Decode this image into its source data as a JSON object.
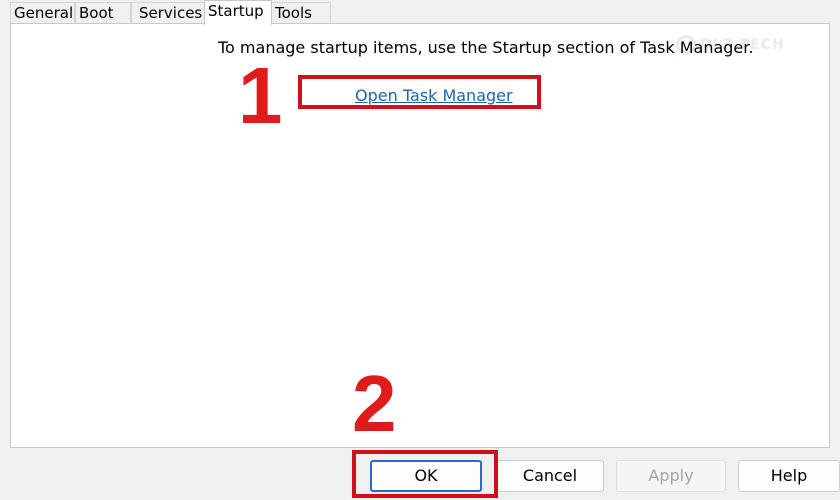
{
  "tabs": [
    {
      "label": "General",
      "active": false
    },
    {
      "label": "Boot",
      "active": false
    },
    {
      "label": "Services",
      "active": false
    },
    {
      "label": "Startup",
      "active": true
    },
    {
      "label": "Tools",
      "active": false
    }
  ],
  "startup": {
    "info_text": "To manage startup items, use the Startup section of Task Manager.",
    "link_label": "Open Task Manager"
  },
  "buttons": {
    "ok": "OK",
    "cancel": "Cancel",
    "apply": "Apply",
    "help": "Help"
  },
  "annotations": {
    "step1": "1",
    "step2": "2",
    "color": "#d1111a"
  },
  "watermark": {
    "text": "DLZ TECH"
  },
  "colors": {
    "link": "#1f63b0",
    "default_button_border": "#2a6ad6"
  }
}
